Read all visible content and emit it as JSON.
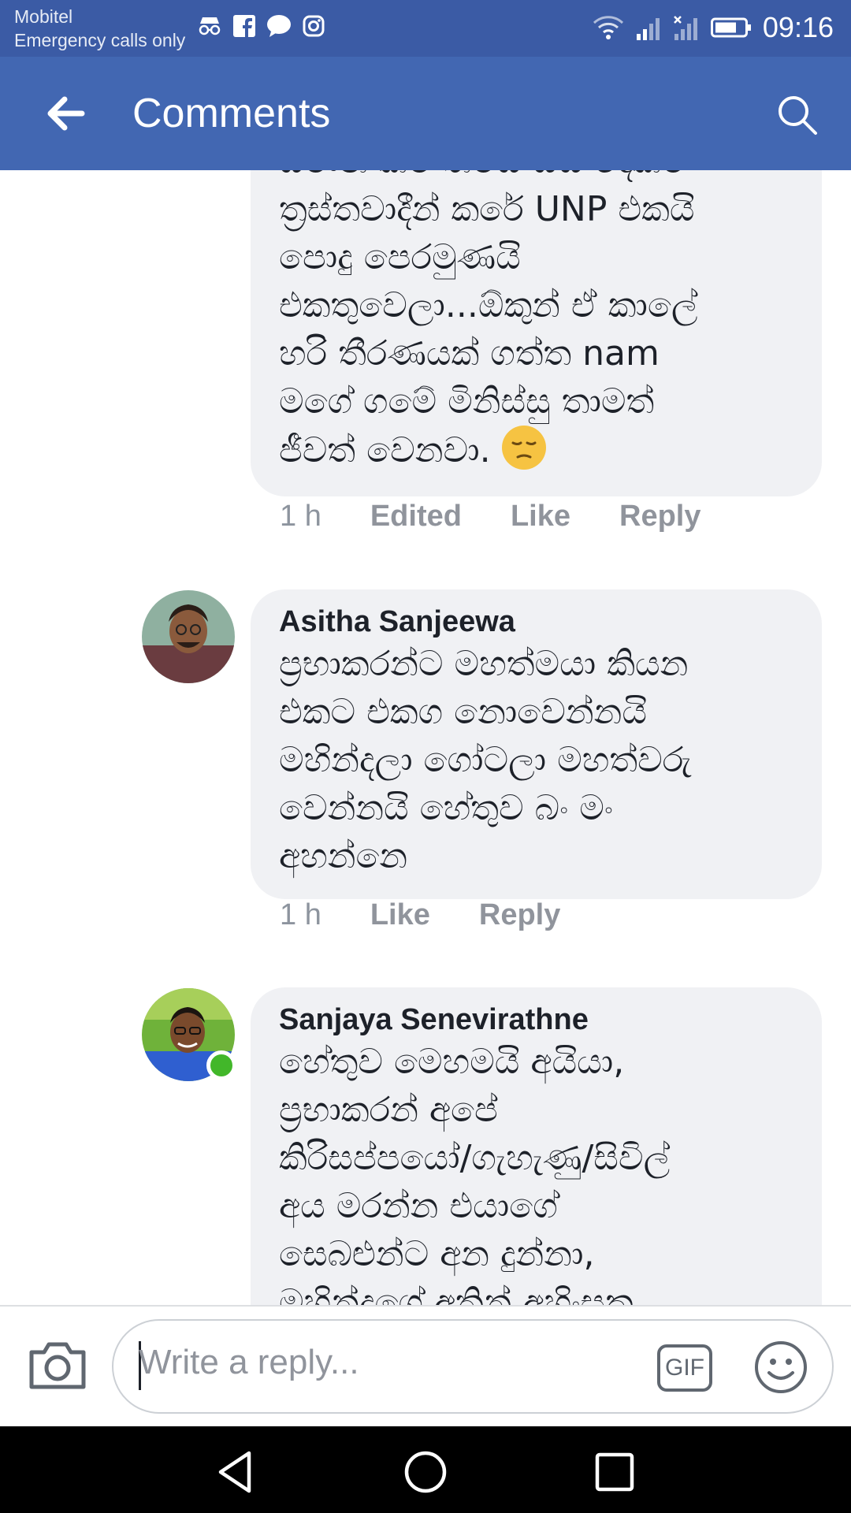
{
  "status_bar": {
    "carrier": "Mobitel",
    "emergency": "Emergency calls only",
    "time": "09:16"
  },
  "app_bar": {
    "title": "Comments"
  },
  "comments": [
    {
      "author": "",
      "text": "සමාන කම තමයි ඔය දෙකම\nත්‍රස්තවාදීන් කරේ UNP එකයි\nපොදු පෙරමුණයි\nඑකතුවෙලා...ඕකුන් ඒ කාලේ\nහරි තීරණයක් ගත්ත nam\nමගේ ගමේ මිනිස්සු තාමත්\nජීවත් වෙනවා.",
      "time": "1 h",
      "edited": "Edited",
      "like": "Like",
      "reply": "Reply"
    },
    {
      "author": "Asitha Sanjeewa",
      "text": "ප්‍රභාකරන්ට මහත්මයා කියන\nඑකට එකග නොවෙන්නයි\nමහින්දලා ගෝටලා මහත්වරු\nවෙන්නයි හේතුව බං මං\nඅහන්නෙ",
      "time": "1 h",
      "like": "Like",
      "reply": "Reply"
    },
    {
      "author": "Sanjaya Senevirathne",
      "text": "හේතුව මෙහමයි අයියා,\nප්‍රභාකරන් අපේ\nකිරිසප්පයෝ/ගැහැණු/සිවිල්\nඅය  මරන්න එයාගේ\nසෙබළුන්ට අන දුන්නා,\nමහින්දගේ අතින් අහිංසක"
    }
  ],
  "composer": {
    "placeholder": "Write a reply...",
    "gif_label": "GIF"
  },
  "icons": {
    "back": "arrow-left-icon",
    "search": "search-icon",
    "camera": "camera-icon",
    "sticker": "smiley-icon"
  },
  "colors": {
    "status_bar": "#3b5ba5",
    "app_bar": "#4267b2",
    "bubble": "#f0f1f4",
    "meta_text": "#8d949e",
    "online": "#42b72a"
  }
}
